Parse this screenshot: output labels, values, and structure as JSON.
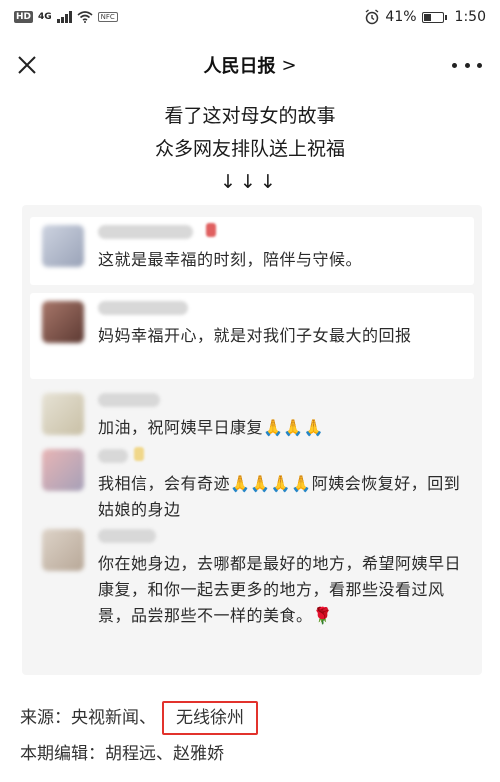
{
  "status_bar": {
    "network": "4G",
    "hd_badge": "HD",
    "battery_percent": "41%",
    "time": "1:50",
    "battery_level": 0.41
  },
  "nav": {
    "title": "人民日报",
    "title_chevron": ">"
  },
  "headline": {
    "line1": "看了这对母女的故事",
    "line2": "众多网友排队送上祝福",
    "arrows": "↓↓↓"
  },
  "comments": [
    {
      "text": "这就是最幸福的时刻，陪伴与守候。"
    },
    {
      "text": "妈妈幸福开心，就是对我们子女最大的回报"
    },
    {
      "text": "加油，祝阿姨早日康复🙏🙏🙏"
    },
    {
      "text": "我相信，会有奇迹🙏🙏🙏🙏阿姨会恢复好，回到姑娘的身边"
    },
    {
      "text": "你在她身边，去哪都是最好的地方，希望阿姨早日康复，和你一起去更多的地方，看那些没看过风景，品尝那些不一样的美食。🌹"
    }
  ],
  "footer": {
    "source_label": "来源：",
    "source_1": "央视新闻、",
    "source_2": "无线徐州",
    "editor_label": "本期编辑：",
    "editors": "胡程远、赵雅娇"
  },
  "colors": {
    "highlight_border": "#e2322c",
    "panel_bg": "#f5f5f5"
  }
}
